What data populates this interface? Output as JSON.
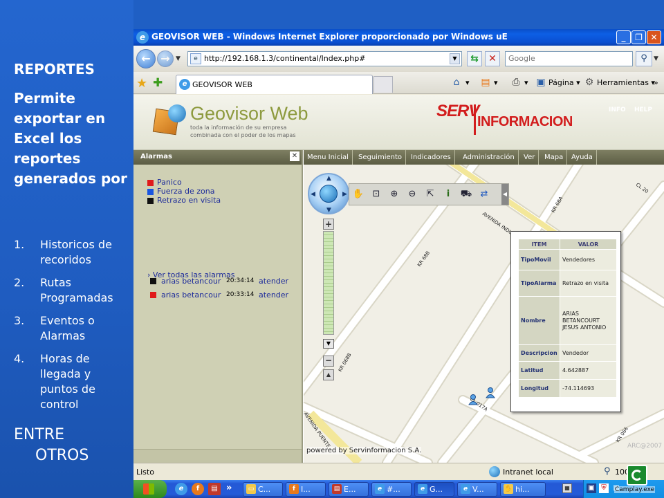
{
  "slide": {
    "heading": "REPORTES",
    "intro": "Permite exportar en Excel los reportes generados por",
    "items": [
      {
        "num": "1.",
        "text": "Historicos de recoridos"
      },
      {
        "num": "2.",
        "text": "Rutas Programadas"
      },
      {
        "num": "3.",
        "text": "Eventos o Alarmas"
      },
      {
        "num": "4.",
        "text": "Horas de llegada y puntos de control"
      }
    ],
    "footer_line1": "ENTRE",
    "footer_line2": "OTROS"
  },
  "browser": {
    "title": "GEOVISOR WEB - Windows Internet Explorer proporcionado por Windows uE",
    "address": "http://192.168.1.3/continental/Index.php#",
    "search_placeholder": "Google",
    "tab_label": "GEOVISOR WEB",
    "cmd_page": "Página",
    "cmd_tools": "Herramientas",
    "status_text": "Listo",
    "zone_text": "Intranet local",
    "zoom_text": "100"
  },
  "app": {
    "logo_title": "Geovisor Web",
    "tagline_1": "toda la información de su empresa",
    "tagline_2": "combinada con el poder de los mapas",
    "brand_serv": "SERV",
    "brand_info": "INFORMACION",
    "top_links": [
      "INFO",
      "HELP"
    ],
    "menu": [
      "Menu Inicial",
      "Seguimiento",
      "Indicadores",
      "Administración",
      "Ver",
      "Mapa",
      "Ayuda"
    ],
    "powered_by": "powered by Servinformacion S.A.",
    "copyright": "ARC@2007"
  },
  "alarms": {
    "title": "Alarmas",
    "legend": [
      {
        "label": "Panico",
        "color": "#e01b1b"
      },
      {
        "label": "Fuerza de zona",
        "color": "#1a56e0"
      },
      {
        "label": "Retrazo en visita",
        "color": "#111111"
      }
    ],
    "see_all": "Ver todas las alarmas",
    "rows": [
      {
        "color": "#111111",
        "name": "arias betancour",
        "time": "20:34:14",
        "action": "atender"
      },
      {
        "color": "#e01b1b",
        "name": "arias betancour",
        "time": "20:33:14",
        "action": "atender"
      }
    ]
  },
  "map": {
    "streets": [
      "KR 68A",
      "KR 68B",
      "AVENIDA INDUSTRIAL",
      "CL 20",
      "KR 068B",
      "CL 017A",
      "AVENIDA PUENTE",
      "KR 066"
    ]
  },
  "info_popup": {
    "headers": [
      "ITEM",
      "VALOR"
    ],
    "rows": [
      {
        "key": "TipoMovil",
        "value": "Vendedores"
      },
      {
        "key": "TipoAlarma",
        "value": "Retrazo en visita"
      },
      {
        "key": "Nombre",
        "value": "ARIAS BETANCOURT JESUS ANTONIO"
      },
      {
        "key": "Descripcion",
        "value": "Vendedor"
      },
      {
        "key": "Latitud",
        "value": "4.642887"
      },
      {
        "key": "Longitud",
        "value": "-74.114693"
      }
    ]
  },
  "taskbar": {
    "buttons": [
      {
        "label": "C...",
        "icon": "folder-icon",
        "color": "#f2c94c"
      },
      {
        "label": "I...",
        "icon": "firefox-icon",
        "color": "#e8791c"
      },
      {
        "label": "E...",
        "icon": "notebook-icon",
        "color": "#c0392b"
      },
      {
        "label": "#...",
        "icon": "ie-icon",
        "color": "#3f9be8"
      },
      {
        "label": "G...",
        "icon": "ie-icon",
        "color": "#3f9be8"
      },
      {
        "label": "V...",
        "icon": "ie-icon",
        "color": "#3f9be8"
      },
      {
        "label": "hi...",
        "icon": "hand-icon",
        "color": "#f2c94c"
      }
    ]
  },
  "overlay": {
    "camplay_label": "Camplay.exe"
  }
}
